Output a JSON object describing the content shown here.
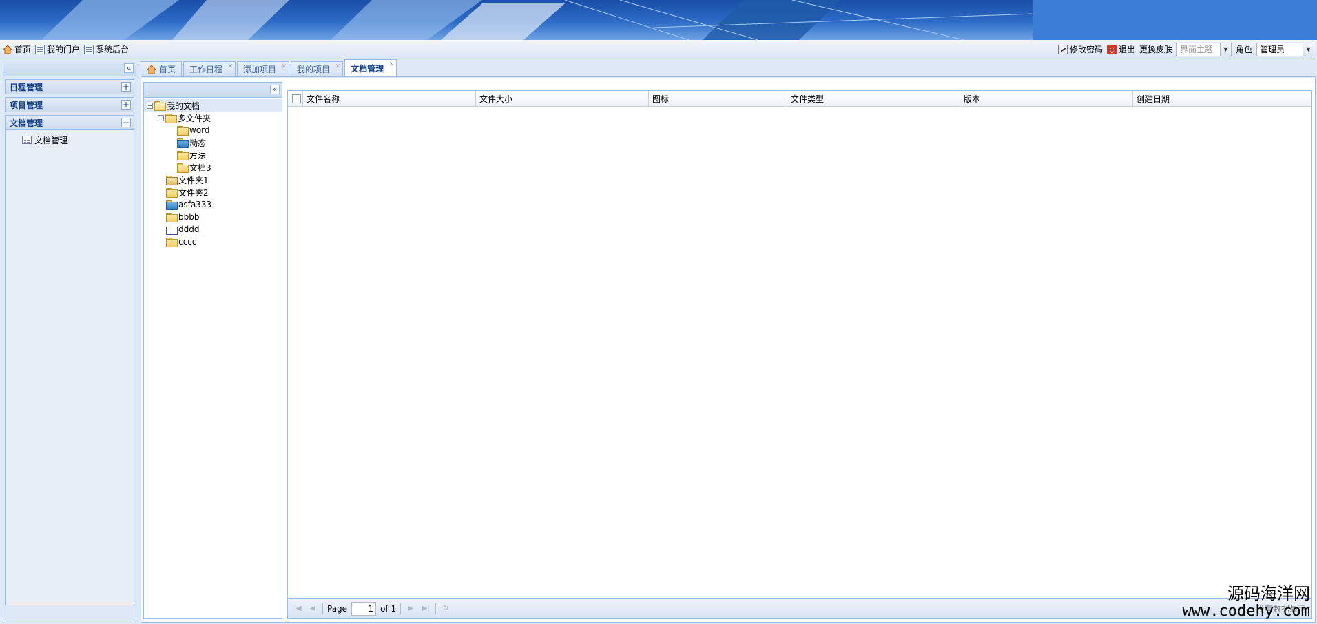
{
  "topbar": {
    "home": "首页",
    "portal": "我的门户",
    "admin": "系统后台",
    "change_password": "修改密码",
    "logout": "退出",
    "skin_label": "更换皮肤",
    "skin_placeholder": "界面主题",
    "role_label": "角色",
    "role_value": "管理员"
  },
  "west": {
    "sections": [
      {
        "title": "日程管理",
        "tool": "+"
      },
      {
        "title": "项目管理",
        "tool": "+"
      },
      {
        "title": "文档管理",
        "tool": "−"
      }
    ],
    "active_items": [
      "文档管理"
    ]
  },
  "tabs": [
    {
      "label": "首页",
      "icon": "home-icon",
      "closable": false
    },
    {
      "label": "工作日程",
      "closable": true
    },
    {
      "label": "添加项目",
      "closable": true
    },
    {
      "label": "我的项目",
      "closable": true
    },
    {
      "label": "文档管理",
      "closable": true,
      "active": true
    }
  ],
  "tree": {
    "root": "我的文档",
    "nodes": [
      {
        "label": "多文件夹",
        "level": 1,
        "type": "folder-user",
        "expanded": true
      },
      {
        "label": "word",
        "level": 2,
        "type": "folder-user"
      },
      {
        "label": "动态",
        "level": 2,
        "type": "folder-ppt"
      },
      {
        "label": "方法",
        "level": 2,
        "type": "folder-user"
      },
      {
        "label": "文档3",
        "level": 2,
        "type": "folder"
      },
      {
        "label": "文件夹1",
        "level": 1,
        "type": "folder-img"
      },
      {
        "label": "文件夹2",
        "level": 1,
        "type": "folder"
      },
      {
        "label": "asfa333",
        "level": 1,
        "type": "folder-ppt"
      },
      {
        "label": "bbbb",
        "level": 1,
        "type": "folder"
      },
      {
        "label": "dddd",
        "level": 1,
        "type": "doc"
      },
      {
        "label": "cccc",
        "level": 1,
        "type": "folder"
      }
    ]
  },
  "grid": {
    "columns": [
      "文件名称",
      "文件大小",
      "图标",
      "文件类型",
      "版本",
      "创建日期"
    ],
    "rows": []
  },
  "pager": {
    "page_label": "Page",
    "page_value": "1",
    "of_label": "of 1",
    "message": "没有数据显示"
  },
  "watermark": {
    "line1": "源码海洋网",
    "line2": "www.codehy.com"
  }
}
